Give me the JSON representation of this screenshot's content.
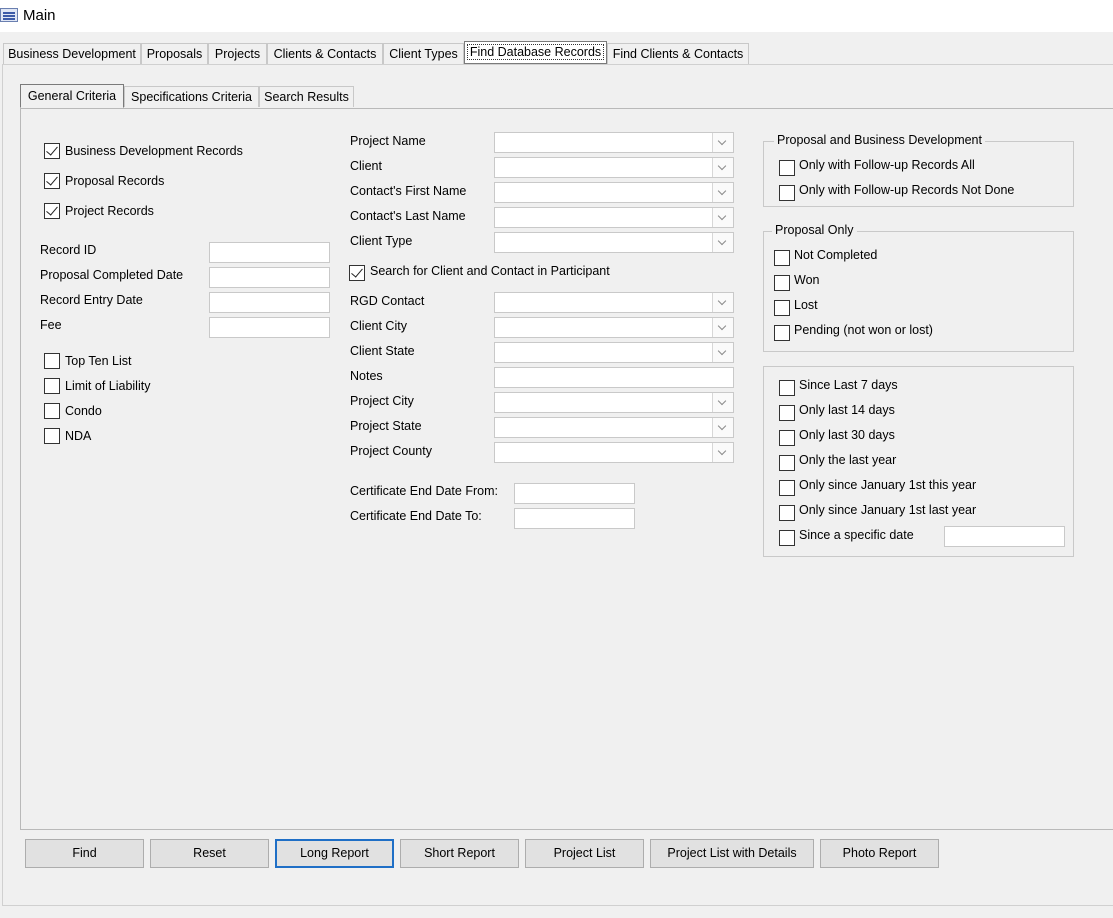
{
  "window": {
    "title": "Main"
  },
  "main_tabs": [
    "Business Development",
    "Proposals",
    "Projects",
    "Clients & Contacts",
    "Client Types",
    "Find Database Records",
    "Find Clients & Contacts"
  ],
  "sub_tabs": [
    "General Criteria",
    "Specifications Criteria",
    "Search Results"
  ],
  "record_types": [
    {
      "label": "Business Development Records",
      "checked": true
    },
    {
      "label": "Proposal Records",
      "checked": true
    },
    {
      "label": "Project Records",
      "checked": true
    }
  ],
  "id_fields": [
    {
      "label": "Record ID",
      "value": ""
    },
    {
      "label": "Proposal Completed Date",
      "value": ""
    },
    {
      "label": "Record Entry Date",
      "value": ""
    },
    {
      "label": "Fee",
      "value": ""
    }
  ],
  "flags": [
    {
      "label": "Top Ten List",
      "checked": false
    },
    {
      "label": "Limit of Liability",
      "checked": false
    },
    {
      "label": "Condo",
      "checked": false
    },
    {
      "label": "NDA",
      "checked": false
    }
  ],
  "criteria_top": [
    {
      "label": "Project Name",
      "value": ""
    },
    {
      "label": "Client",
      "value": ""
    },
    {
      "label": "Contact's First Name",
      "value": ""
    },
    {
      "label": "Contact's Last Name",
      "value": ""
    },
    {
      "label": "Client Type",
      "value": ""
    }
  ],
  "participant_search": {
    "label": "Search for Client and Contact in Participant",
    "checked": true
  },
  "criteria_bottom": [
    {
      "label": "RGD Contact",
      "value": "",
      "combo": true
    },
    {
      "label": "Client City",
      "value": "",
      "combo": true
    },
    {
      "label": "Client State",
      "value": "",
      "combo": true
    },
    {
      "label": "Notes",
      "value": "",
      "combo": false
    },
    {
      "label": "Project City",
      "value": "",
      "combo": true
    },
    {
      "label": "Project State",
      "value": "",
      "combo": true
    },
    {
      "label": "Project County",
      "value": "",
      "combo": true
    }
  ],
  "certificate": [
    {
      "label": "Certificate End Date From:",
      "value": ""
    },
    {
      "label": "Certificate End Date To:",
      "value": ""
    }
  ],
  "followup_group": {
    "title": "Proposal and Business Development",
    "items": [
      {
        "label": "Only with Follow-up Records All",
        "checked": false
      },
      {
        "label": "Only with Follow-up Records Not Done",
        "checked": false
      }
    ]
  },
  "proposal_group": {
    "title": "Proposal Only",
    "items": [
      {
        "label": "Not Completed",
        "checked": false
      },
      {
        "label": "Won",
        "checked": false
      },
      {
        "label": "Lost",
        "checked": false
      },
      {
        "label": "Pending (not won or lost)",
        "checked": false
      }
    ]
  },
  "date_group": {
    "items": [
      {
        "label": "Since Last 7 days",
        "checked": false
      },
      {
        "label": "Only last 14 days",
        "checked": false
      },
      {
        "label": "Only last 30 days",
        "checked": false
      },
      {
        "label": "Only the last year",
        "checked": false
      },
      {
        "label": "Only since January 1st this year",
        "checked": false
      },
      {
        "label": "Only since January 1st last year",
        "checked": false
      },
      {
        "label": "Since a specific date",
        "checked": false
      }
    ],
    "specific_date_value": ""
  },
  "buttons": [
    "Find",
    "Reset",
    "Long Report",
    "Short Report",
    "Project List",
    "Project List with Details",
    "Photo Report"
  ]
}
